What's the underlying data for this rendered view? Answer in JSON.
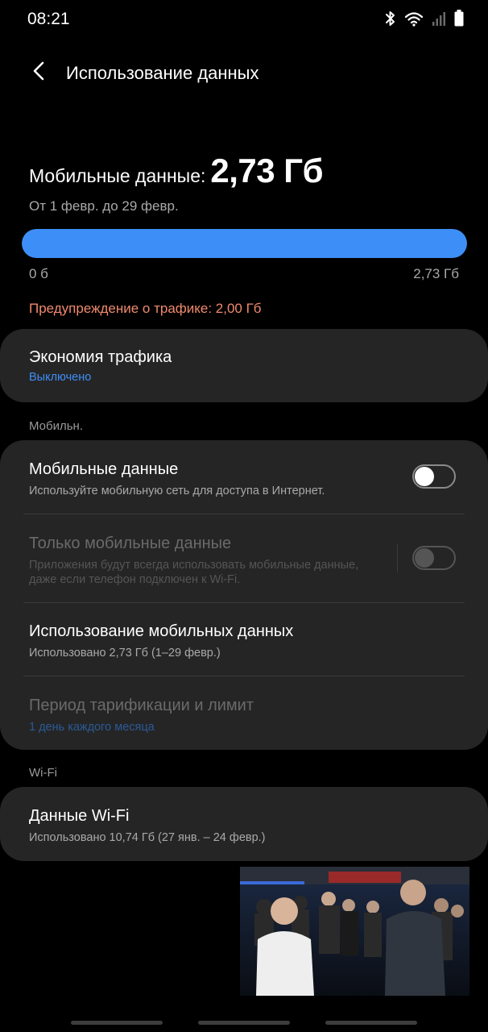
{
  "status_bar": {
    "time": "08:21",
    "icons": [
      "bluetooth-icon",
      "wifi-icon",
      "signal-icon",
      "battery-icon"
    ]
  },
  "header": {
    "back_icon": "back-arrow-icon",
    "title": "Использование данных"
  },
  "usage": {
    "label": "Мобильные данные:",
    "value": "2,73 Гб",
    "period": "От 1 февр. до 29 февр.",
    "bar_fill_fraction": 1.0,
    "bar_min_label": "0 б",
    "bar_max_label": "2,73 Гб",
    "warning": "Предупреждение о трафике: 2,00 Гб"
  },
  "data_saver": {
    "title": "Экономия трафика",
    "status": "Выключено"
  },
  "mobile_section": {
    "header": "Мобильн.",
    "items": [
      {
        "title": "Мобильные данные",
        "subtitle": "Используйте мобильную сеть для доступа в Интернет.",
        "toggle": false,
        "enabled": true
      },
      {
        "title": "Только мобильные данные",
        "subtitle": "Приложения будут всегда использовать мобильные данные, даже если телефон подключен к Wi-Fi.",
        "toggle": false,
        "enabled": false
      },
      {
        "title": "Использование мобильных данных",
        "subtitle": "Использовано 2,73 Гб (1–29 февр.)",
        "enabled": true
      },
      {
        "title": "Период тарификации и лимит",
        "subtitle": "1 день каждого месяца",
        "enabled": false
      }
    ]
  },
  "wifi_section": {
    "header": "Wi-Fi",
    "item": {
      "title": "Данные Wi-Fi",
      "subtitle": "Использовано 10,74 Гб (27 янв. – 24 февр.)"
    }
  },
  "colors": {
    "background": "#000000",
    "card": "#252525",
    "accent_blue": "#3e8ef7",
    "warning": "#f08a6c",
    "secondary_text": "#a9a9a9"
  }
}
